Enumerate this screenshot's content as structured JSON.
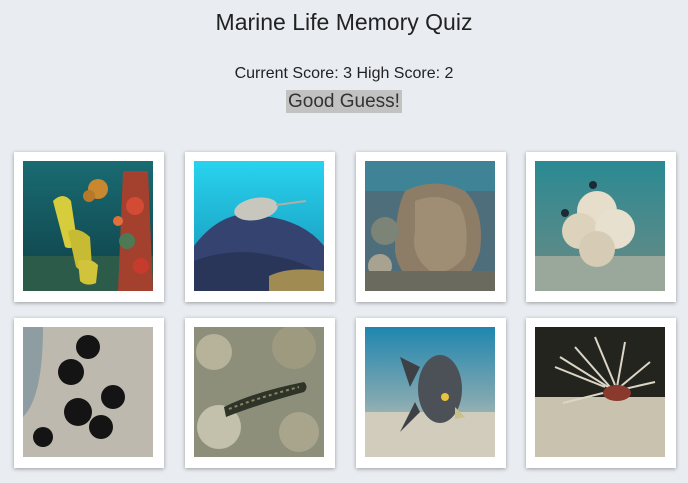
{
  "app": {
    "title": "Marine Life Memory Quiz"
  },
  "score": {
    "current_label": "Current Score:",
    "current_value": "3",
    "high_label": "High Score:",
    "high_value": "2"
  },
  "feedback": {
    "message": "Good Guess!"
  },
  "cards": [
    {
      "subject": "tube-sponge-reef",
      "palette": [
        "#1e7f86",
        "#d7cc3b",
        "#c13a2d"
      ]
    },
    {
      "subject": "stingray",
      "palette": [
        "#1fc3e0",
        "#3c4e82",
        "#c9c7be"
      ]
    },
    {
      "subject": "stonefish",
      "palette": [
        "#5b7a8a",
        "#8a7d6a",
        "#bdb6a6"
      ]
    },
    {
      "subject": "coral-with-fish",
      "palette": [
        "#2c7f8c",
        "#e8e0cf",
        "#7a9b8c"
      ]
    },
    {
      "subject": "sea-urchins",
      "palette": [
        "#8f9ea3",
        "#151515",
        "#c4c1b8"
      ]
    },
    {
      "subject": "moray-eel",
      "palette": [
        "#8a8d7a",
        "#3a3f2e",
        "#b7b39b"
      ]
    },
    {
      "subject": "french-angelfish",
      "palette": [
        "#2b8bb1",
        "#4b4f55",
        "#d8d3c4"
      ]
    },
    {
      "subject": "lionfish",
      "palette": [
        "#2a2a24",
        "#cfc8b5",
        "#e7e0d6"
      ]
    }
  ]
}
